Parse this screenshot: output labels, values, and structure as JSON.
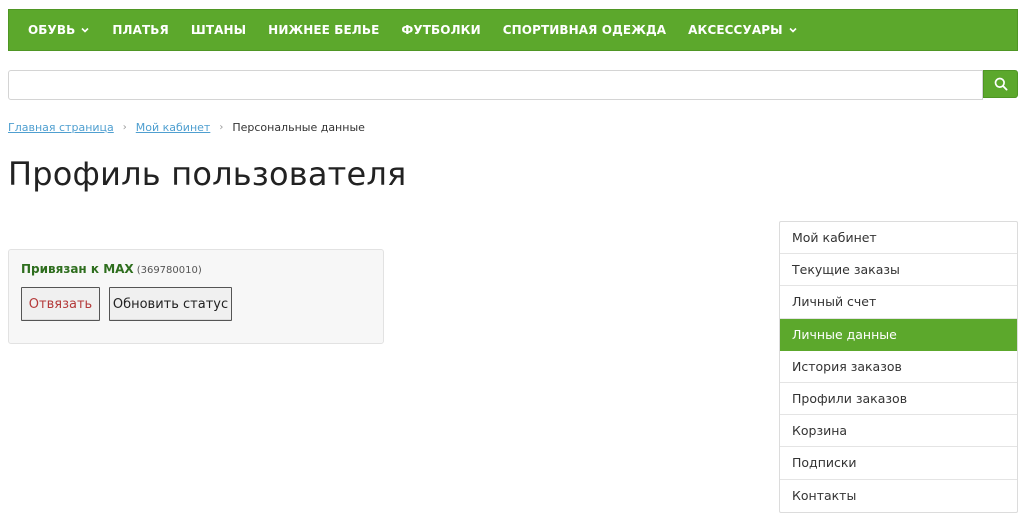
{
  "colors": {
    "accent": "#5ca82c",
    "link": "#4f9fd0",
    "bound": "#2e6e1e",
    "danger": "#b43a3a"
  },
  "nav": {
    "items": [
      {
        "label": "ОБУВЬ",
        "has_dropdown": true
      },
      {
        "label": "ПЛАТЬЯ",
        "has_dropdown": false
      },
      {
        "label": "ШТАНЫ",
        "has_dropdown": false
      },
      {
        "label": "НИЖНЕЕ БЕЛЬЕ",
        "has_dropdown": false
      },
      {
        "label": "ФУТБОЛКИ",
        "has_dropdown": false
      },
      {
        "label": "СПОРТИВНАЯ ОДЕЖДА",
        "has_dropdown": false
      },
      {
        "label": "АКСЕССУАРЫ",
        "has_dropdown": true
      }
    ]
  },
  "search": {
    "value": "",
    "placeholder": "",
    "icon": "search-icon"
  },
  "breadcrumb": {
    "items": [
      {
        "label": "Главная страница",
        "link": true
      },
      {
        "label": "Мой кабинет",
        "link": true
      },
      {
        "label": "Персональные данные",
        "link": false
      }
    ]
  },
  "page": {
    "title": "Профиль пользователя"
  },
  "binding": {
    "status_label": "Привязан к MAX",
    "id_text": "(369780010)",
    "unbind_label": "Отвязать",
    "refresh_label": "Обновить статус"
  },
  "sidebar": {
    "items": [
      {
        "label": "Мой кабинет",
        "active": false
      },
      {
        "label": "Текущие заказы",
        "active": false
      },
      {
        "label": "Личный счет",
        "active": false
      },
      {
        "label": "Личные данные",
        "active": true
      },
      {
        "label": "История заказов",
        "active": false
      },
      {
        "label": "Профили заказов",
        "active": false
      },
      {
        "label": "Корзина",
        "active": false
      },
      {
        "label": "Подписки",
        "active": false
      },
      {
        "label": "Контакты",
        "active": false
      }
    ]
  }
}
